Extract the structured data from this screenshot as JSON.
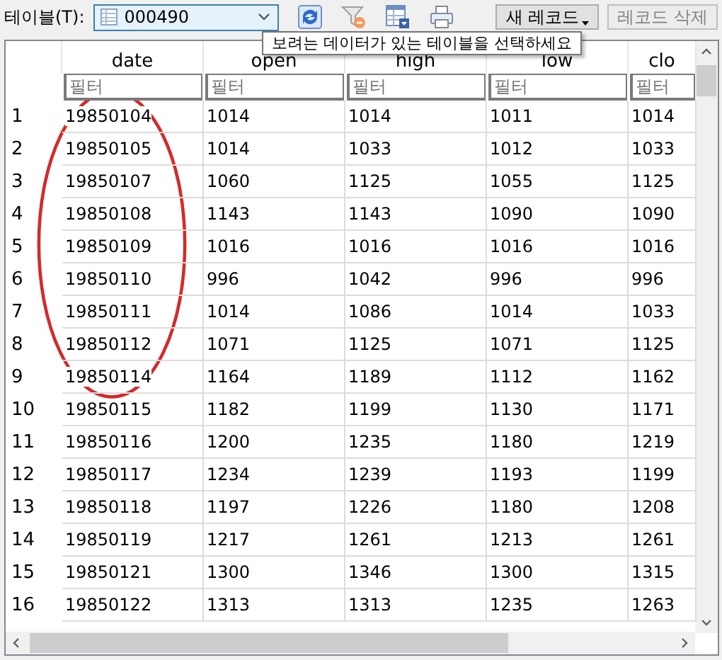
{
  "toolbar": {
    "table_label": "테이블(T):",
    "table_select": {
      "value": "000490"
    },
    "new_record_button": {
      "label": "새 레코드",
      "has_menu": true,
      "disabled": false
    },
    "delete_record_button": {
      "label": "레코드 삭제",
      "disabled": true
    }
  },
  "tooltip": {
    "text": "보려는 데이터가 있는 테이블을 선택하세요"
  },
  "table": {
    "columns": [
      {
        "label": "date",
        "filter_placeholder": "필터"
      },
      {
        "label": "open",
        "filter_placeholder": "필터"
      },
      {
        "label": "high",
        "filter_placeholder": "필터"
      },
      {
        "label": "low",
        "filter_placeholder": "필터"
      },
      {
        "label": "clo",
        "filter_placeholder": "필터"
      }
    ],
    "rows": [
      {
        "number": "1",
        "cells": [
          "19850104",
          "1014",
          "1014",
          "1011",
          "1014"
        ]
      },
      {
        "number": "2",
        "cells": [
          "19850105",
          "1014",
          "1033",
          "1012",
          "1033"
        ]
      },
      {
        "number": "3",
        "cells": [
          "19850107",
          "1060",
          "1125",
          "1055",
          "1125"
        ]
      },
      {
        "number": "4",
        "cells": [
          "19850108",
          "1143",
          "1143",
          "1090",
          "1090"
        ]
      },
      {
        "number": "5",
        "cells": [
          "19850109",
          "1016",
          "1016",
          "1016",
          "1016"
        ]
      },
      {
        "number": "6",
        "cells": [
          "19850110",
          "996",
          "1042",
          "996",
          "996"
        ]
      },
      {
        "number": "7",
        "cells": [
          "19850111",
          "1014",
          "1086",
          "1014",
          "1033"
        ]
      },
      {
        "number": "8",
        "cells": [
          "19850112",
          "1071",
          "1125",
          "1071",
          "1125"
        ]
      },
      {
        "number": "9",
        "cells": [
          "19850114",
          "1164",
          "1189",
          "1112",
          "1162"
        ]
      },
      {
        "number": "10",
        "cells": [
          "19850115",
          "1182",
          "1199",
          "1130",
          "1171"
        ]
      },
      {
        "number": "11",
        "cells": [
          "19850116",
          "1200",
          "1235",
          "1180",
          "1219"
        ]
      },
      {
        "number": "12",
        "cells": [
          "19850117",
          "1234",
          "1239",
          "1193",
          "1199"
        ]
      },
      {
        "number": "13",
        "cells": [
          "19850118",
          "1197",
          "1226",
          "1180",
          "1208"
        ]
      },
      {
        "number": "14",
        "cells": [
          "19850119",
          "1217",
          "1261",
          "1213",
          "1261"
        ]
      },
      {
        "number": "15",
        "cells": [
          "19850121",
          "1300",
          "1346",
          "1300",
          "1315"
        ]
      },
      {
        "number": "16",
        "cells": [
          "19850122",
          "1313",
          "1313",
          "1235",
          "1263"
        ]
      }
    ]
  }
}
